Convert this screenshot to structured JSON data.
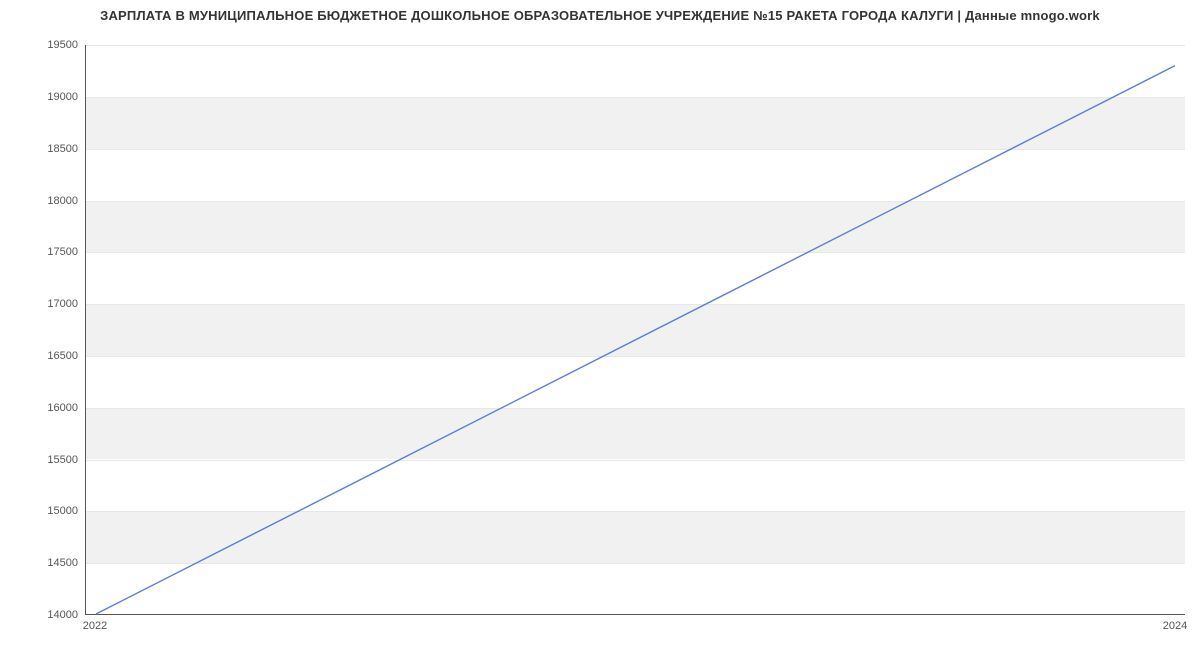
{
  "chart_data": {
    "type": "line",
    "title": "ЗАРПЛАТА В МУНИЦИПАЛЬНОЕ БЮДЖЕТНОЕ ДОШКОЛЬНОЕ ОБРАЗОВАТЕЛЬНОЕ УЧРЕЖДЕНИЕ №15 РАКЕТА ГОРОДА КАЛУГИ | Данные mnogo.work",
    "xlabel": "",
    "ylabel": "",
    "x": [
      2022,
      2024
    ],
    "values": [
      14000,
      19300
    ],
    "xlim": [
      2022,
      2024
    ],
    "ylim": [
      14000,
      19500
    ],
    "yticks": [
      14000,
      14500,
      15000,
      15500,
      16000,
      16500,
      17000,
      17500,
      18000,
      18500,
      19000,
      19500
    ],
    "xticks": [
      2022,
      2024
    ],
    "line_color": "#5a7fd6",
    "grid_band_color": "#f1f1f1"
  }
}
